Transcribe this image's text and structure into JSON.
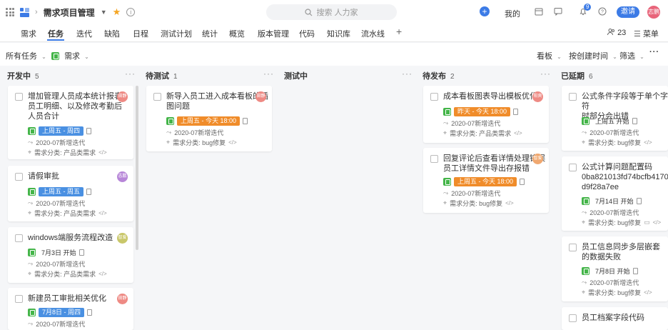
{
  "topbar": {
    "project_name": "需求项目管理",
    "search_placeholder": "搜索 人力家",
    "mine_label": "我的",
    "notification_count": "9",
    "invite_label": "邀请",
    "user_avatar": "志鹏"
  },
  "nav": {
    "tabs": [
      "需求",
      "任务",
      "迭代",
      "缺陷",
      "日程",
      "测试计划",
      "统计",
      "概览",
      "版本管理",
      "代码",
      "知识库",
      "流水线"
    ],
    "active_tab": "任务",
    "member_count": "23",
    "menu_label": "菜单"
  },
  "filters": {
    "all_tasks": "所有任务",
    "type": "需求",
    "view": "看板",
    "sort": "按创建时间",
    "filter": "筛选"
  },
  "columns": [
    {
      "title": "开发中",
      "count": "5"
    },
    {
      "title": "待测试",
      "count": "1"
    },
    {
      "title": "测试中",
      "count": ""
    },
    {
      "title": "待发布",
      "count": "2"
    },
    {
      "title": "已延期",
      "count": "6"
    }
  ],
  "cards": {
    "c1": {
      "title_l1": "增加管理人员成本统计报表",
      "title_l2": "员工明细、以及修改考勤后",
      "title_l3": "人员合计",
      "avatar": "田静",
      "date": "上周五 - 周四",
      "iter": "2020-07新增迭代",
      "cat": "需求分类: 产品类需求"
    },
    "c2": {
      "title_l1": "请假审批",
      "avatar": "志鹏",
      "date": "上周五 - 周五",
      "iter": "2020-07新增迭代",
      "cat": "需求分类: 产品类需求"
    },
    "c3": {
      "title_l1": "windows端服务流程改造",
      "avatar": "智爱",
      "date": "7月3日 开始",
      "iter": "2020-07新增迭代",
      "cat": "需求分类: 产品类需求"
    },
    "c4": {
      "title_l1": "新建员工审批相关优化",
      "avatar": "田静",
      "date": "7月8日 - 周四",
      "iter": "2020-07新增迭代"
    },
    "c5": {
      "title_l1": "新导入员工进入成本看板的插",
      "title_l2": "图问题",
      "avatar": "田静",
      "date": "上周五 - 今天 18:00",
      "iter": "2020-07新增迭代",
      "cat": "需求分类: bug修复"
    },
    "c6": {
      "title_l1": "成本看板图表导出模板优化",
      "avatar": "阳爽",
      "date": "昨天 - 今天 18:00",
      "iter": "2020-07新增迭代",
      "cat": "需求分类: 产品类需求"
    },
    "c7": {
      "title_l1": "回复评论后查看详情处理错误",
      "title_l2": "员工详情文件导出存报错",
      "avatar": "智爱",
      "date": "上周五 - 今天 18:00",
      "iter": "2020-07新增迭代",
      "cat": "需求分类: bug修复"
    },
    "c8": {
      "title_l1": "公式条件字段等于单个字符",
      "title_l2": "时部分会出错",
      "date": "上周五 开始",
      "iter": "2020-07新增迭代",
      "cat": "需求分类: bug修复"
    },
    "c9": {
      "title_l1": "公式计算问题配置码",
      "title_l2": "0ba821013fd74bcfb4170fe",
      "title_l3": "d9f28a7ee",
      "date": "7月14日 开始",
      "iter": "2020-07新增迭代",
      "cat": "需求分类: bug修复"
    },
    "c10": {
      "title_l1": "员工信息同步多层嵌套",
      "title_l2": "的数据失败",
      "date": "7月8日 开始",
      "iter": "2020-07新增迭代",
      "cat": "需求分类: bug修复"
    },
    "c11": {
      "title_l1": "员工档案字段代码"
    }
  },
  "colors": {
    "accent": "#3c7be6",
    "green": "#44b549",
    "tag_blue": "#4a90e2",
    "tag_orange": "#f08c2a"
  }
}
